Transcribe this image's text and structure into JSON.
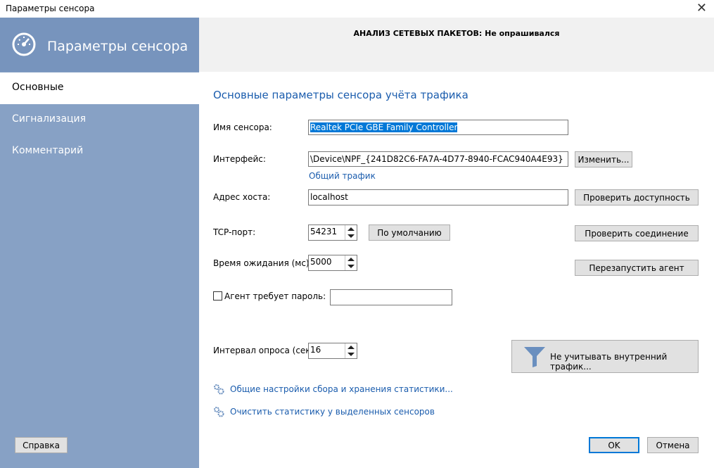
{
  "window": {
    "title": "Параметры сенсора",
    "close_glyph": "✕"
  },
  "sidebar": {
    "title": "Параметры сенсора",
    "items": [
      {
        "label": "Основные",
        "active": true
      },
      {
        "label": "Сигнализация",
        "active": false
      },
      {
        "label": "Комментарий",
        "active": false
      }
    ],
    "help_button": "Справка"
  },
  "header": {
    "status": "АНАЛИЗ СЕТЕВЫХ ПАКЕТОВ: Не опрашивался"
  },
  "form": {
    "section_title": "Основные параметры сенсора учёта трафика",
    "sensor_name_label": "Имя сенсора:",
    "sensor_name_value": "Realtek PCIe GBE Family Controller",
    "interface_label": "Интерфейс:",
    "interface_value": "\\Device\\NPF_{241D82C6-FA7A-4D77-8940-FCAC940A4E93}",
    "change_button": "Изменить...",
    "total_traffic_link": "Общий трафик",
    "host_label": "Адрес хоста:",
    "host_value": "localhost",
    "check_availability_button": "Проверить доступность",
    "tcp_port_label": "TCP-порт:",
    "tcp_port_value": "54231",
    "default_button": "По умолчанию",
    "check_connection_button": "Проверить соединение",
    "timeout_label": "Время ожидания (мс):",
    "timeout_value": "5000",
    "restart_agent_button": "Перезапустить агент",
    "password_checkbox_label": "Агент требует пароль:",
    "password_checked": false,
    "password_value": "",
    "poll_interval_label": "Интервал опроса (сек.):",
    "poll_interval_value": "16",
    "ignore_internal_button": "Не учитывать внутренний трафик...",
    "general_settings_link": "Общие настройки сбора и хранения статистики...",
    "clear_stats_link": "Очистить статистику у выделенных сенсоров"
  },
  "footer": {
    "ok_button": "OK",
    "cancel_button": "Отмена"
  },
  "colors": {
    "sidebar": "#87a1c5",
    "sidebar_header": "#7794bd",
    "accent": "#1a5cad",
    "selection": "#0078d7"
  }
}
